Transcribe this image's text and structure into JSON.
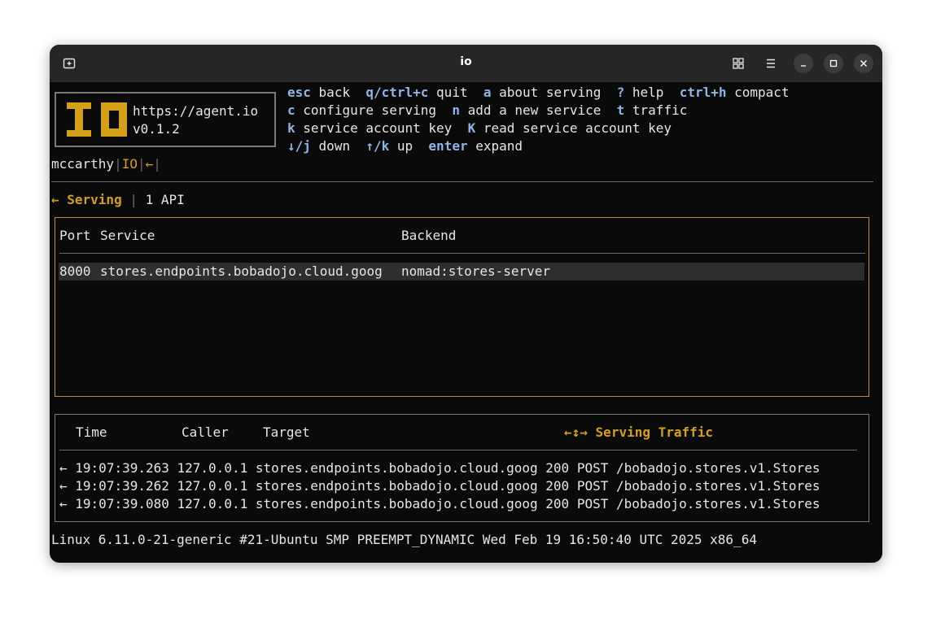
{
  "window": {
    "title": "io"
  },
  "logo": {
    "url": "https://agent.io",
    "version": "v0.1.2"
  },
  "shortcuts": [
    [
      {
        "key": "esc",
        "label": "back"
      },
      {
        "key": "q/ctrl+c",
        "label": "quit"
      },
      {
        "key": "a",
        "label": "about serving"
      },
      {
        "key": "?",
        "label": "help"
      },
      {
        "key": "ctrl+h",
        "label": "compact"
      }
    ],
    [
      {
        "key": "c",
        "label": "configure serving"
      },
      {
        "key": "n",
        "label": "add a new service"
      },
      {
        "key": "t",
        "label": "traffic"
      }
    ],
    [
      {
        "key": "k",
        "label": "service account key"
      },
      {
        "key": "K",
        "label": "read service account key"
      }
    ],
    [
      {
        "key": "↓/j",
        "label": "down"
      },
      {
        "key": "↑/k",
        "label": "up"
      },
      {
        "key": "enter",
        "label": "expand"
      }
    ]
  ],
  "status_line": {
    "user": "mccarthy",
    "brand": "IO",
    "arrow": "←"
  },
  "breadcrumb": {
    "back": "← Serving",
    "count": "1 API"
  },
  "serving_table": {
    "headers": {
      "port": "Port",
      "service": "Service",
      "backend": "Backend"
    },
    "rows": [
      {
        "port": "8000",
        "service": "stores.endpoints.bobadojo.cloud.goog",
        "backend": "nomad:stores-server"
      }
    ]
  },
  "traffic": {
    "title": "Serving Traffic",
    "title_icon": "↔ arrows-icon",
    "headers": {
      "time": "Time",
      "caller": "Caller",
      "target": "Target"
    },
    "rows": [
      {
        "dir": "←",
        "time": "19:07:39.263",
        "caller": "127.0.0.1",
        "target": "stores.endpoints.bobadojo.cloud.goog",
        "status": "200",
        "method": "POST",
        "path": "/bobadojo.stores.v1.Stores"
      },
      {
        "dir": "←",
        "time": "19:07:39.262",
        "caller": "127.0.0.1",
        "target": "stores.endpoints.bobadojo.cloud.goog",
        "status": "200",
        "method": "POST",
        "path": "/bobadojo.stores.v1.Stores"
      },
      {
        "dir": "←",
        "time": "19:07:39.080",
        "caller": "127.0.0.1",
        "target": "stores.endpoints.bobadojo.cloud.goog",
        "status": "200",
        "method": "POST",
        "path": "/bobadojo.stores.v1.Stores"
      }
    ]
  },
  "footer": "Linux 6.11.0-21-generic #21-Ubuntu SMP PREEMPT_DYNAMIC Wed Feb 19 16:50:40 UTC 2025 x86_64",
  "colors": {
    "accent": "#d4a017",
    "key": "#8fb4e8",
    "background": "#0a0a0a"
  }
}
